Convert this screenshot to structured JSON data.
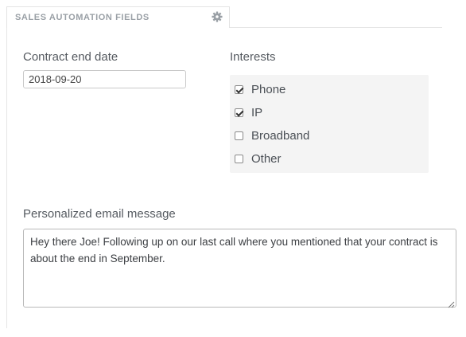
{
  "section": {
    "title": "SALES AUTOMATION FIELDS",
    "settings_icon": "gear-icon"
  },
  "contract": {
    "label": "Contract end date",
    "value": "2018-09-20"
  },
  "interests": {
    "label": "Interests",
    "options": [
      {
        "label": "Phone",
        "checked": true
      },
      {
        "label": "IP",
        "checked": true
      },
      {
        "label": "Broadband",
        "checked": false
      },
      {
        "label": "Other",
        "checked": false
      }
    ]
  },
  "email": {
    "label": "Personalized email message",
    "value": "Hey there Joe! Following up on our last call where you mentioned that your contract is about the end in September."
  },
  "colors": {
    "spellcheck_underline": "#d93025",
    "interests_bg": "#f4f4f4",
    "label_text": "#555a60"
  }
}
